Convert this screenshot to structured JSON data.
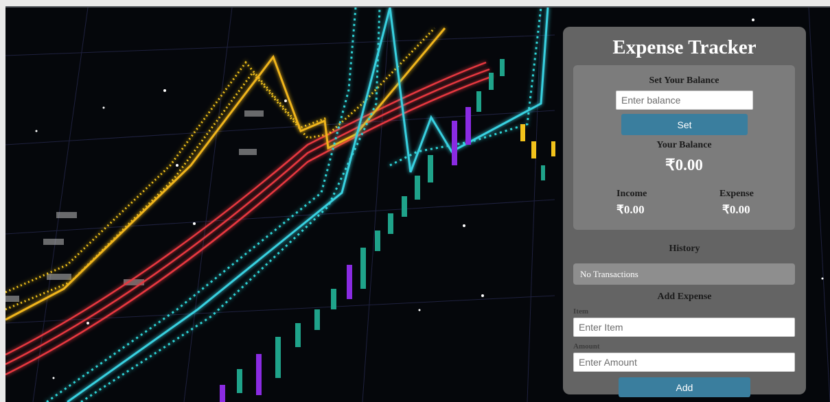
{
  "app": {
    "title": "Expense Tracker"
  },
  "balance_section": {
    "heading": "Set Your Balance",
    "input_placeholder": "Enter balance",
    "set_button": "Set",
    "your_balance_label": "Your Balance",
    "balance_value": "₹0.00",
    "income_label": "Income",
    "income_value": "₹0.00",
    "expense_label": "Expense",
    "expense_value": "₹0.00"
  },
  "history": {
    "heading": "History",
    "empty_text": "No Transactions"
  },
  "add_expense": {
    "heading": "Add Expense",
    "item_label": "Item",
    "item_placeholder": "Enter Item",
    "amount_label": "Amount",
    "amount_placeholder": "Enter Amount",
    "add_button": "Add"
  },
  "colors": {
    "accent": "#3a7e9e",
    "panel": "#6c6c6c",
    "chart_yellow": "#f2c21b",
    "chart_red": "#e8383f",
    "chart_cyan": "#39d1e0",
    "candle_teal": "#1fa38a",
    "candle_purple": "#8a2be2"
  },
  "background": {
    "description_icon": "stock-chart-background"
  }
}
